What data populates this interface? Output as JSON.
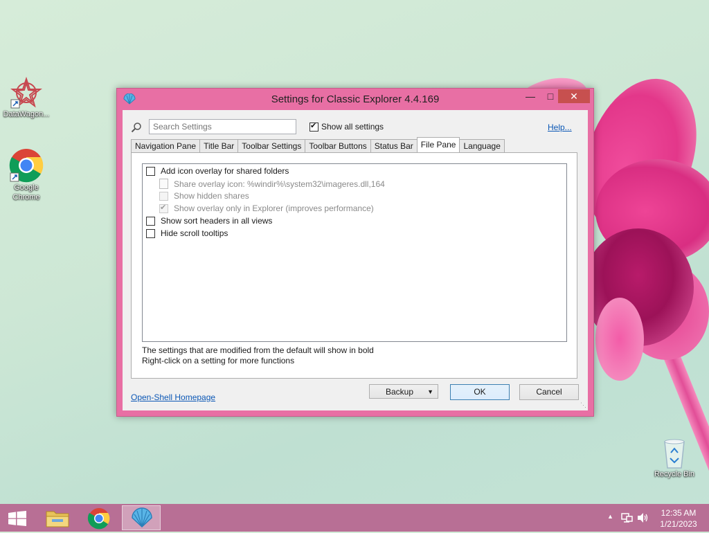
{
  "desktop": {
    "icons": [
      {
        "label": "DataWagon..."
      },
      {
        "label": "Google Chrome"
      },
      {
        "label": "Recycle Bin"
      }
    ]
  },
  "dialog": {
    "title": "Settings for Classic Explorer 4.4.169",
    "search_placeholder": "Search Settings",
    "show_all_label": "Show all settings",
    "show_all_checked": true,
    "help_label": "Help...",
    "tabs": [
      {
        "label": "Navigation Pane",
        "active": false
      },
      {
        "label": "Title Bar",
        "active": false
      },
      {
        "label": "Toolbar Settings",
        "active": false
      },
      {
        "label": "Toolbar Buttons",
        "active": false
      },
      {
        "label": "Status Bar",
        "active": false
      },
      {
        "label": "File Pane",
        "active": true
      },
      {
        "label": "Language",
        "active": false
      }
    ],
    "options": [
      {
        "label": "Add icon overlay for shared folders",
        "checked": false,
        "enabled": true
      },
      {
        "label": "Share overlay icon: %windir%\\system32\\imageres.dll,164",
        "enabled": false
      },
      {
        "label": "Show hidden shares",
        "checked": false,
        "enabled": false
      },
      {
        "label": "Show overlay only in Explorer (improves performance)",
        "checked": true,
        "enabled": false
      },
      {
        "label": "Show sort headers in all views",
        "checked": false,
        "enabled": true
      },
      {
        "label": "Hide scroll tooltips",
        "checked": false,
        "enabled": true
      }
    ],
    "notes": [
      "The settings that are modified from the default will show in bold",
      "Right-click on a setting for more functions"
    ],
    "homepage_link": "Open-Shell Homepage",
    "buttons": {
      "backup": "Backup",
      "ok": "OK",
      "cancel": "Cancel"
    }
  },
  "taskbar": {
    "clock_time": "12:35 AM",
    "clock_date": "1/21/2023"
  },
  "colors": {
    "dialog_frame": "#e86fa4",
    "taskbar": "#b86f95",
    "close_button": "#c7504f",
    "link": "#0b57b5"
  }
}
